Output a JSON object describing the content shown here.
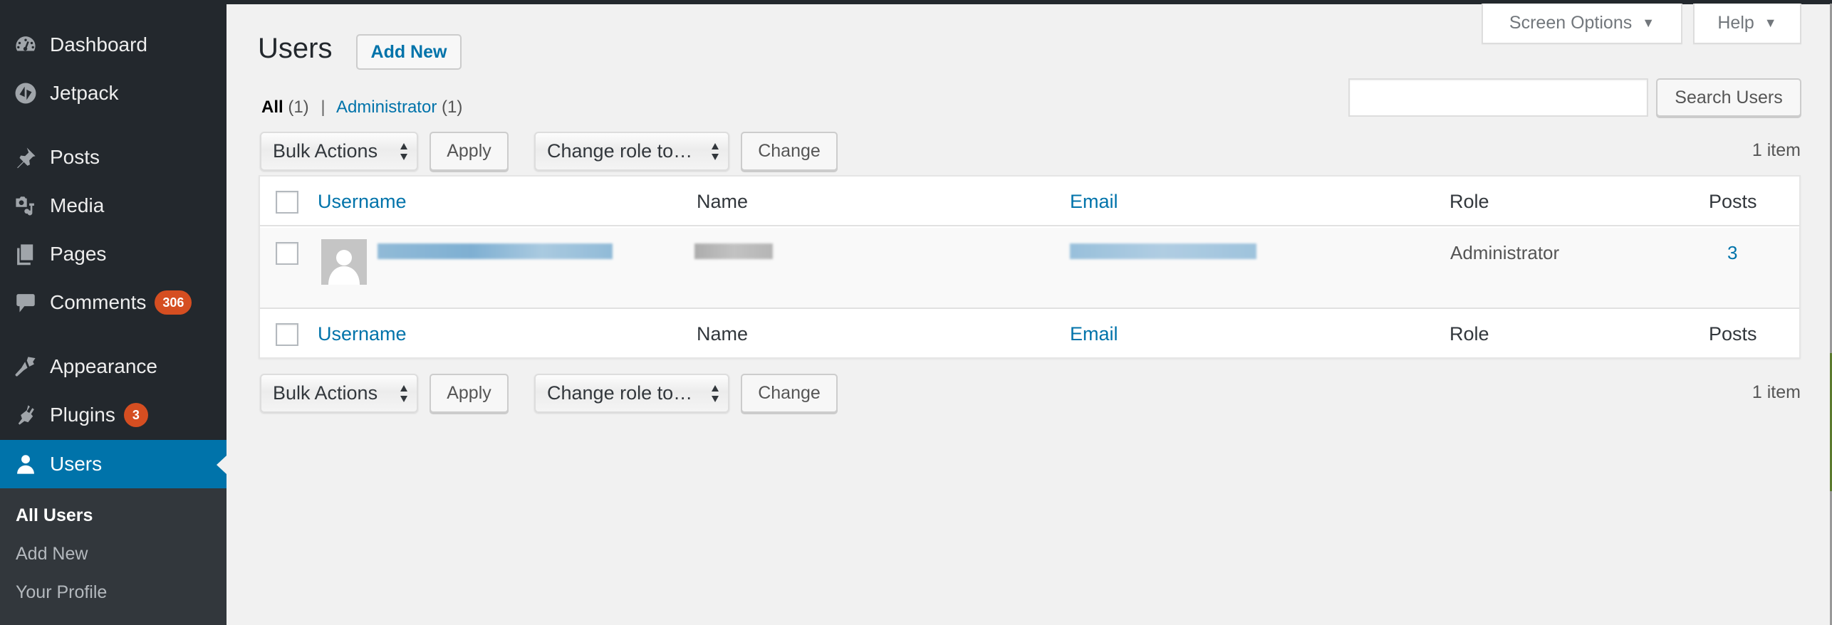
{
  "sidebar": {
    "items": [
      {
        "label": "Dashboard",
        "icon": "dashboard-icon"
      },
      {
        "label": "Jetpack",
        "icon": "jetpack-icon"
      },
      {
        "label": "Posts",
        "icon": "pin-icon"
      },
      {
        "label": "Media",
        "icon": "media-icon"
      },
      {
        "label": "Pages",
        "icon": "pages-icon"
      },
      {
        "label": "Comments",
        "icon": "comment-icon",
        "badge": "306"
      },
      {
        "label": "Appearance",
        "icon": "paintbrush-icon"
      },
      {
        "label": "Plugins",
        "icon": "plugin-icon",
        "badge": "3"
      },
      {
        "label": "Users",
        "icon": "user-icon",
        "current": true
      }
    ],
    "submenu": [
      {
        "label": "All Users",
        "current": true
      },
      {
        "label": "Add New"
      },
      {
        "label": "Your Profile"
      }
    ]
  },
  "header": {
    "title": "Users",
    "add_new_label": "Add New",
    "screen_options_label": "Screen Options",
    "help_label": "Help"
  },
  "filters": {
    "all_label": "All",
    "all_count": "(1)",
    "separator": "|",
    "admin_label": "Administrator",
    "admin_count": "(1)"
  },
  "search": {
    "value": "",
    "button_label": "Search Users"
  },
  "toolbar": {
    "bulk_actions": "Bulk Actions",
    "apply_label": "Apply",
    "change_role": "Change role to…",
    "change_label": "Change",
    "items_count": "1 item"
  },
  "table": {
    "columns": [
      "Username",
      "Name",
      "Email",
      "Role",
      "Posts"
    ],
    "rows": [
      {
        "username": "[redacted]",
        "name": "[redacted]",
        "email": "[redacted]",
        "role": "Administrator",
        "posts": "3"
      }
    ]
  },
  "colors": {
    "accent": "#0073aa",
    "sidebar_bg": "#23282d",
    "submenu_bg": "#32373c",
    "badge": "#d54e21",
    "edge_green": "#5b7a2e"
  }
}
